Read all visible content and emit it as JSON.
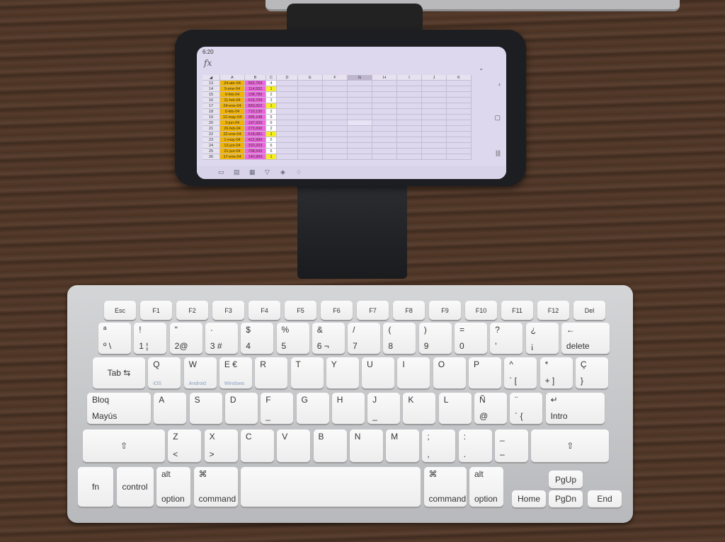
{
  "phone": {
    "status_time": "6:20",
    "formula_icon": "fx",
    "columns": [
      "A",
      "B",
      "C",
      "D",
      "E",
      "F",
      "G",
      "H",
      "I",
      "J",
      "K"
    ],
    "selected_column": "G",
    "rows": [
      {
        "n": "13",
        "a": "24-abr-04",
        "b": "562,759",
        "c": "4"
      },
      {
        "n": "14",
        "a": "5-ene-04",
        "b": "114,552",
        "c": "1"
      },
      {
        "n": "15",
        "a": "9-feb-04",
        "b": "108,789",
        "c": "2"
      },
      {
        "n": "16",
        "a": "11-feb-04",
        "b": "919,709",
        "c": "3"
      },
      {
        "n": "17",
        "a": "24-ene-04",
        "b": "850,552",
        "c": "1"
      },
      {
        "n": "18",
        "a": "6-feb-04",
        "b": "710,130",
        "c": "2"
      },
      {
        "n": "19",
        "a": "12-may-04",
        "b": "395,148",
        "c": "5"
      },
      {
        "n": "20",
        "a": "3-jun-04",
        "b": "197,926",
        "c": "6"
      },
      {
        "n": "21",
        "a": "26-feb-04",
        "b": "273,690",
        "c": "2"
      },
      {
        "n": "22",
        "a": "22-ene-04",
        "b": "618,081",
        "c": "1"
      },
      {
        "n": "23",
        "a": "1-may-04",
        "b": "422,990",
        "c": "5"
      },
      {
        "n": "24",
        "a": "13-jun-04",
        "b": "320,203",
        "c": "6"
      },
      {
        "n": "25",
        "a": "21-jun-04",
        "b": "708,542",
        "c": "6"
      },
      {
        "n": "26",
        "a": "17-ene-04",
        "b": "140,900",
        "c": "1"
      }
    ],
    "colors": {
      "col_a": "#f2b400",
      "col_b": "#ee66dd",
      "highlight": "#f5ee20"
    },
    "toolbar_icons": [
      "screen-icon",
      "sheet-icon",
      "table-icon",
      "filter-icon",
      "fill-icon",
      "bulb-icon"
    ]
  },
  "keyboard": {
    "rows": [
      [
        [
          "",
          "Esc"
        ],
        [
          "",
          "F1"
        ],
        [
          "",
          "F2"
        ],
        [
          "",
          "F3"
        ],
        [
          "",
          "F4"
        ],
        [
          "",
          "F5"
        ],
        [
          "",
          "F6"
        ],
        [
          "",
          "F7"
        ],
        [
          "",
          "F8"
        ],
        [
          "",
          "F9"
        ],
        [
          "",
          "F10"
        ],
        [
          "",
          "F11"
        ],
        [
          "",
          "F12"
        ],
        [
          "",
          "Del"
        ]
      ],
      [
        [
          "ª",
          "º \\"
        ],
        [
          "!",
          "1 ¦"
        ],
        [
          "\"",
          "2@"
        ],
        [
          "·",
          "3 #"
        ],
        [
          "$",
          "4"
        ],
        [
          "%",
          "5"
        ],
        [
          "&",
          "6 ¬"
        ],
        [
          "/",
          "7"
        ],
        [
          "(",
          "8"
        ],
        [
          ")",
          "9"
        ],
        [
          "=",
          "0"
        ],
        [
          "?",
          "'"
        ],
        [
          "¿",
          "¡"
        ],
        [
          "←",
          "delete"
        ]
      ],
      [
        [
          "",
          "Tab ⇆"
        ],
        [
          "Q",
          "iOS"
        ],
        [
          "W",
          "Android"
        ],
        [
          "E €",
          "Windows"
        ],
        [
          "R",
          ""
        ],
        [
          "T",
          ""
        ],
        [
          "Y",
          ""
        ],
        [
          "U",
          ""
        ],
        [
          "I",
          ""
        ],
        [
          "O",
          ""
        ],
        [
          "P",
          ""
        ],
        [
          "^",
          "` ["
        ],
        [
          "*",
          "+ ]"
        ],
        [
          "Ç",
          "}"
        ]
      ],
      [
        [
          "Bloq",
          "Mayús"
        ],
        [
          "A",
          ""
        ],
        [
          "S",
          ""
        ],
        [
          "D",
          ""
        ],
        [
          "F",
          "_"
        ],
        [
          "G",
          ""
        ],
        [
          "H",
          ""
        ],
        [
          "J",
          "_"
        ],
        [
          "K",
          ""
        ],
        [
          "L",
          ""
        ],
        [
          "Ñ",
          "@"
        ],
        [
          "¨",
          "´ {"
        ],
        [
          "↵",
          "Intro"
        ]
      ],
      [
        [
          "",
          "⇧"
        ],
        [
          "Z",
          "<"
        ],
        [
          "X",
          ">"
        ],
        [
          "C",
          ""
        ],
        [
          "V",
          ""
        ],
        [
          "B",
          ""
        ],
        [
          "N",
          ""
        ],
        [
          "M",
          ""
        ],
        [
          ";",
          ","
        ],
        [
          ":",
          "."
        ],
        [
          "_",
          "–"
        ],
        [
          "",
          "⇧"
        ]
      ],
      [
        [
          "",
          "fn"
        ],
        [
          "",
          "control"
        ],
        [
          "alt",
          "option"
        ],
        [
          "⌘",
          "command"
        ],
        [
          "",
          ""
        ],
        [
          "⌘",
          "command"
        ],
        [
          "alt",
          "option"
        ],
        [
          "",
          "Home"
        ],
        [
          "",
          "PgUp"
        ],
        [
          "",
          "PgDn"
        ],
        [
          "",
          "End"
        ]
      ]
    ]
  }
}
